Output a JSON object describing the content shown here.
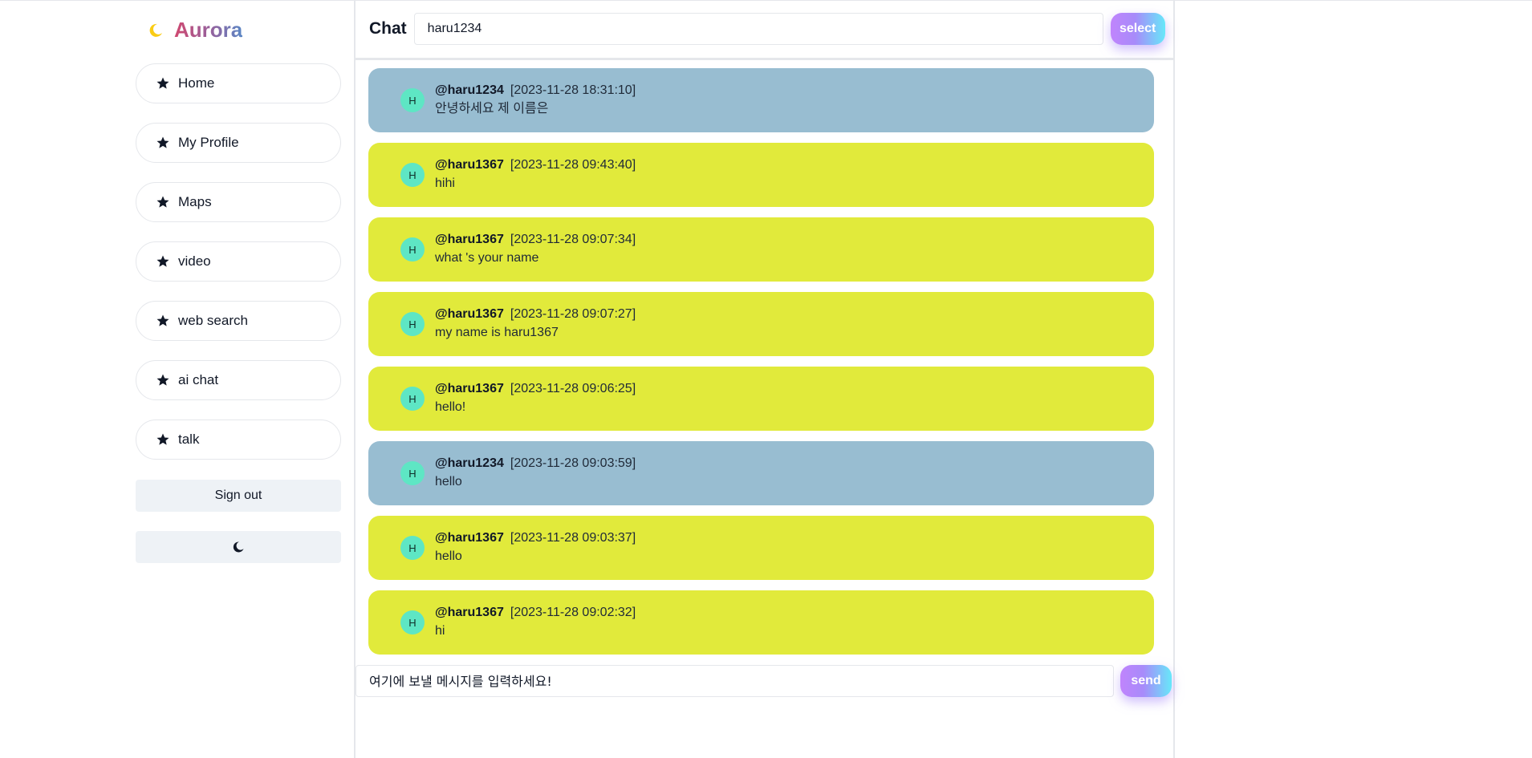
{
  "brand": {
    "name": "Aurora",
    "icon": "moon-icon",
    "icon_color": "#facc15"
  },
  "sidebar": {
    "items": [
      {
        "label": "Home",
        "icon": "star-icon"
      },
      {
        "label": "My Profile",
        "icon": "star-icon"
      },
      {
        "label": "Maps",
        "icon": "star-icon"
      },
      {
        "label": "video",
        "icon": "star-icon"
      },
      {
        "label": "web search",
        "icon": "star-icon"
      },
      {
        "label": "ai chat",
        "icon": "star-icon"
      },
      {
        "label": "talk",
        "icon": "star-icon"
      }
    ],
    "sign_out_label": "Sign out",
    "theme_toggle_icon": "moon-icon"
  },
  "chat": {
    "title": "Chat",
    "room_value": "haru1234",
    "select_label": "select",
    "messages": [
      {
        "avatar": "H",
        "user": "@haru1234",
        "time": "[2023-11-28 18:31:10]",
        "text": "안녕하세요 제 이름은",
        "color": "#98bdd1"
      },
      {
        "avatar": "H",
        "user": "@haru1367",
        "time": "[2023-11-28 09:43:40]",
        "text": "hihi",
        "color": "#e1ea3b"
      },
      {
        "avatar": "H",
        "user": "@haru1367",
        "time": "[2023-11-28 09:07:34]",
        "text": "what 's your name",
        "color": "#e1ea3b"
      },
      {
        "avatar": "H",
        "user": "@haru1367",
        "time": "[2023-11-28 09:07:27]",
        "text": "my name is haru1367",
        "color": "#e1ea3b"
      },
      {
        "avatar": "H",
        "user": "@haru1367",
        "time": "[2023-11-28 09:06:25]",
        "text": "hello!",
        "color": "#e1ea3b"
      },
      {
        "avatar": "H",
        "user": "@haru1234",
        "time": "[2023-11-28 09:03:59]",
        "text": "hello",
        "color": "#98bdd1"
      },
      {
        "avatar": "H",
        "user": "@haru1367",
        "time": "[2023-11-28 09:03:37]",
        "text": "hello",
        "color": "#e1ea3b"
      },
      {
        "avatar": "H",
        "user": "@haru1367",
        "time": "[2023-11-28 09:02:32]",
        "text": "hi",
        "color": "#e1ea3b"
      }
    ],
    "composer_placeholder": "여기에 보낼 메시지를 입력하세요!",
    "send_label": "send"
  }
}
